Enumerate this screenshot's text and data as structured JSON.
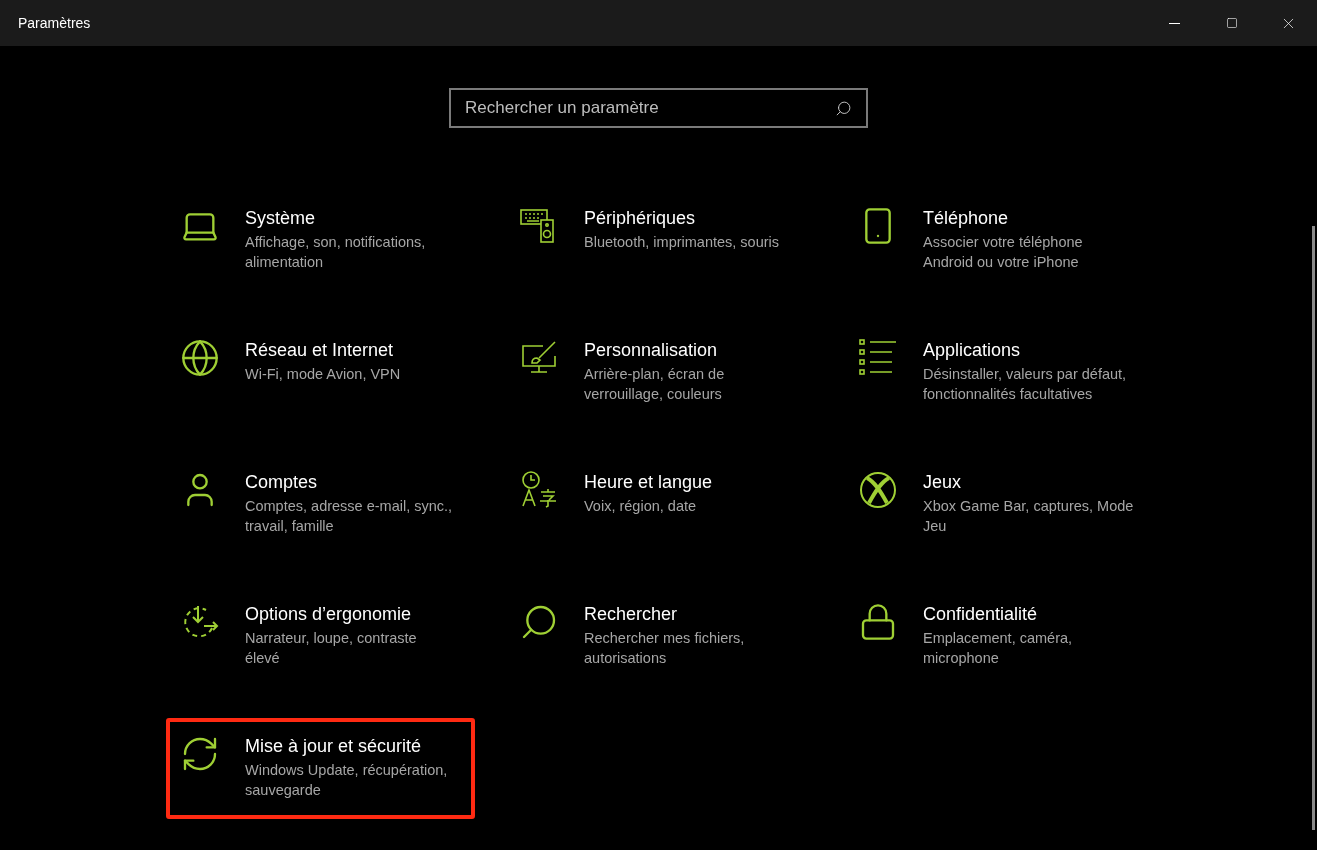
{
  "window": {
    "title": "Paramètres"
  },
  "search": {
    "placeholder": "Rechercher un paramètre"
  },
  "categories": [
    {
      "title": "Système",
      "description_lines": [
        "Affichage, son, notifications,",
        "alimentation"
      ],
      "highlighted": false
    },
    {
      "title": "Périphériques",
      "description_lines": [
        "Bluetooth, imprimantes, souris"
      ],
      "highlighted": false
    },
    {
      "title": "Téléphone",
      "description_lines": [
        "Associer votre téléphone",
        "Android ou votre iPhone"
      ],
      "highlighted": false
    },
    {
      "title": "Réseau et Internet",
      "description_lines": [
        "Wi-Fi, mode Avion, VPN"
      ],
      "highlighted": false
    },
    {
      "title": "Personnalisation",
      "description_lines": [
        "Arrière-plan, écran de",
        "verrouillage, couleurs"
      ],
      "highlighted": false
    },
    {
      "title": "Applications",
      "description_lines": [
        "Désinstaller, valeurs par défaut,",
        "fonctionnalités facultatives"
      ],
      "highlighted": false
    },
    {
      "title": "Comptes",
      "description_lines": [
        "Comptes, adresse e-mail, sync.,",
        "travail, famille"
      ],
      "highlighted": false
    },
    {
      "title": "Heure et langue",
      "description_lines": [
        "Voix, région, date"
      ],
      "highlighted": false
    },
    {
      "title": "Jeux",
      "description_lines": [
        "Xbox Game Bar, captures, Mode",
        "Jeu"
      ],
      "highlighted": false
    },
    {
      "title": "Options d’ergonomie",
      "description_lines": [
        "Narrateur, loupe, contraste",
        "élevé"
      ],
      "highlighted": false
    },
    {
      "title": "Rechercher",
      "description_lines": [
        "Rechercher mes fichiers,",
        "autorisations"
      ],
      "highlighted": false
    },
    {
      "title": "Confidentialité",
      "description_lines": [
        "Emplacement, caméra,",
        "microphone"
      ],
      "highlighted": false
    },
    {
      "title": "Mise à jour et sécurité",
      "description_lines": [
        "Windows Update, récupération,",
        "sauvegarde"
      ],
      "highlighted": true
    }
  ]
}
